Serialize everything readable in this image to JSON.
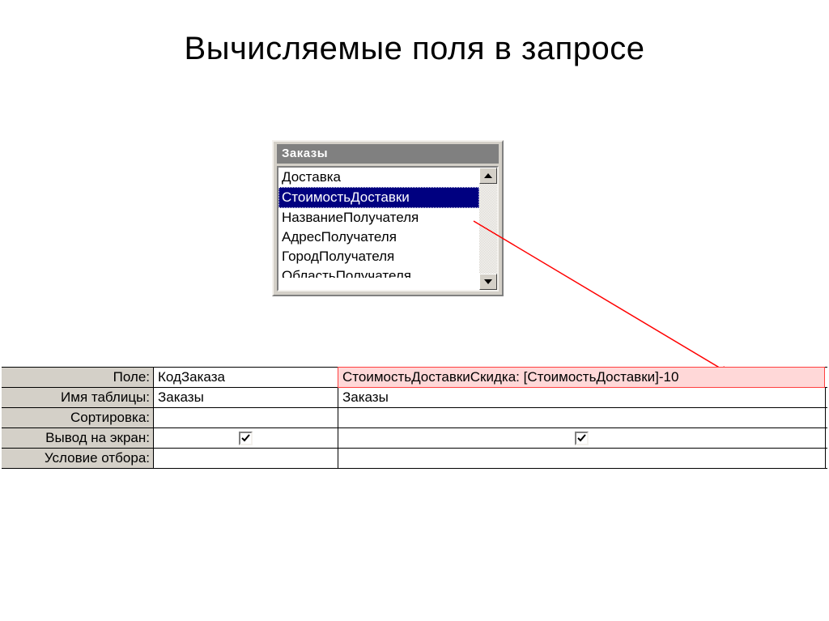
{
  "title": "Вычисляемые поля в запросе",
  "panel": {
    "title": "Заказы",
    "items": [
      "Доставка",
      "СтоимостьДоставки",
      "НазваниеПолучателя",
      "АдресПолучателя",
      "ГородПолучателя",
      "ОбластьПолучателя"
    ],
    "selected_index": 1
  },
  "grid": {
    "labels": {
      "field": "Поле:",
      "table": "Имя таблицы:",
      "sort": "Сортировка:",
      "show": "Вывод на экран:",
      "criteria": "Условие отбора:"
    },
    "col1": {
      "field": "КодЗаказа",
      "table": "Заказы",
      "sort": "",
      "show": true,
      "criteria": ""
    },
    "col2": {
      "field": "СтоимостьДоставкиСкидка: [СтоимостьДоставки]-10",
      "table": "Заказы",
      "sort": "",
      "show": true,
      "criteria": ""
    }
  }
}
